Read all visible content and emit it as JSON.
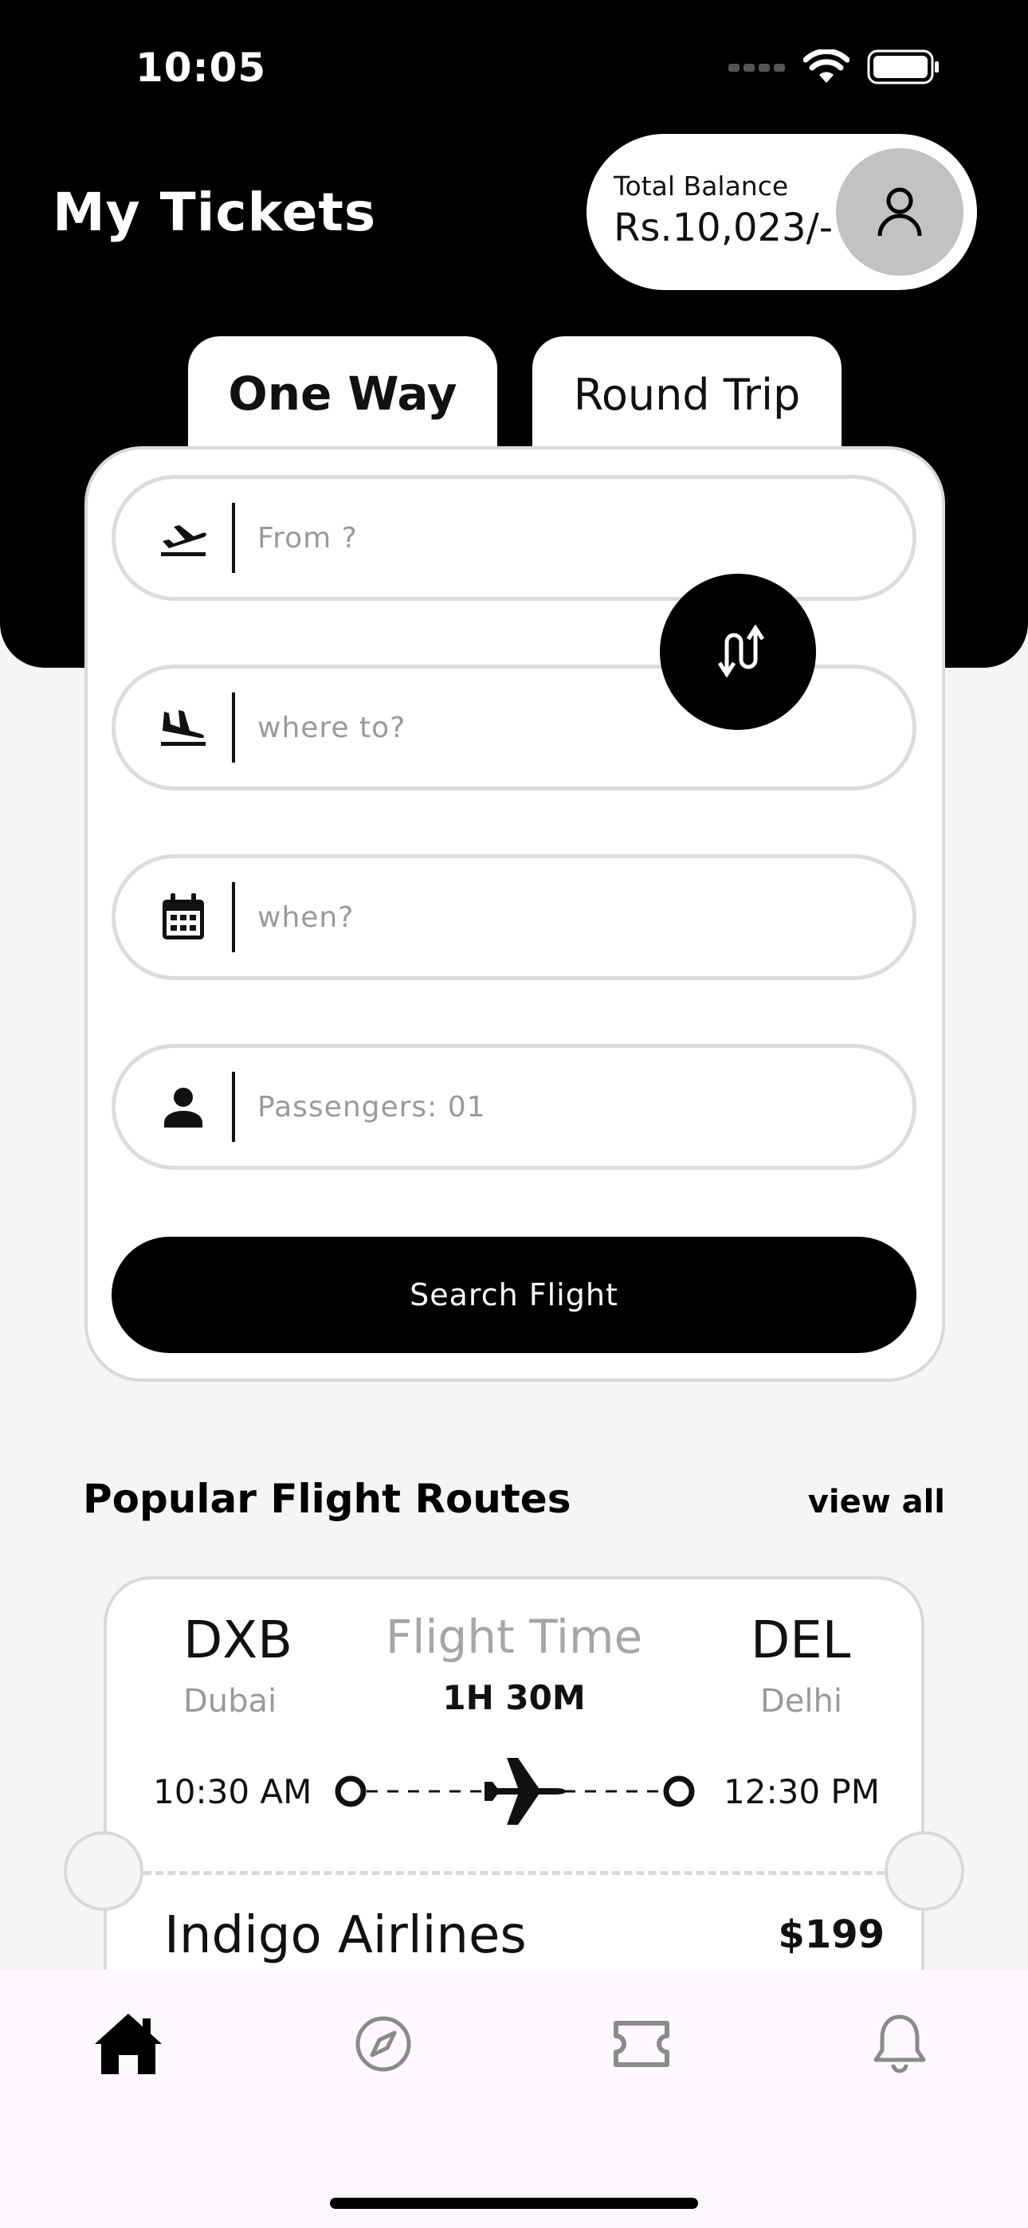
{
  "status_bar": {
    "time": "10:05",
    "icons": [
      "signal-icon",
      "wifi-icon",
      "battery-icon"
    ]
  },
  "header": {
    "title": "My Tickets",
    "balance_label": "Total Balance",
    "balance_value": "Rs.10,023/-",
    "avatar_icon": "user-icon"
  },
  "tabs": [
    {
      "label": "One Way",
      "active": true
    },
    {
      "label": "Round Trip",
      "active": false
    }
  ],
  "form": {
    "from": {
      "placeholder": "From ?",
      "icon": "plane-takeoff-icon"
    },
    "to": {
      "placeholder": "where to?",
      "icon": "plane-landing-icon"
    },
    "date": {
      "placeholder": "when?",
      "icon": "calendar-icon"
    },
    "passengers": {
      "placeholder": "Passengers: 01",
      "icon": "person-icon"
    },
    "swap_icon": "swap-icon",
    "search_label": "Search Flight"
  },
  "popular": {
    "title": "Popular Flight Routes",
    "view_all": "view all",
    "routes": [
      {
        "from_code": "DXB",
        "from_city": "Dubai",
        "to_code": "DEL",
        "to_city": "Delhi",
        "flight_time_label": "Flight Time",
        "flight_time": "1H 30M",
        "depart_time": "10:30 AM",
        "arrive_time": "12:30 PM",
        "airline": "Indigo Airlines",
        "price": "$199"
      }
    ]
  },
  "bottom_nav": [
    {
      "icon": "home-icon",
      "active": true
    },
    {
      "icon": "compass-icon",
      "active": false
    },
    {
      "icon": "ticket-icon",
      "active": false
    },
    {
      "icon": "bell-icon",
      "active": false
    }
  ],
  "colors": {
    "primary": "#000000",
    "background": "#f5f5f5",
    "muted": "#9a9a9a",
    "nav_background": "#fdf8fd"
  }
}
